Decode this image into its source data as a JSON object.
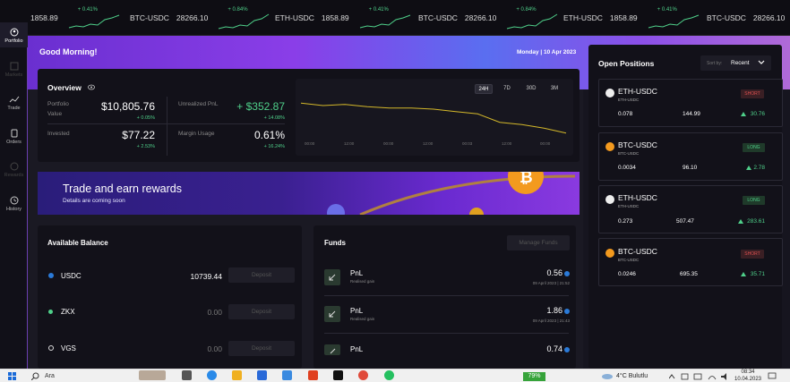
{
  "ticker": [
    {
      "pair": "",
      "price": "1858.89",
      "change": "+ 0.41%"
    },
    {
      "pair": "BTC-USDC",
      "price": "28266.10",
      "change": "+ 0.84%"
    },
    {
      "pair": "ETH-USDC",
      "price": "1858.89",
      "change": "+ 0.41%"
    },
    {
      "pair": "BTC-USDC",
      "price": "28266.10",
      "change": "+ 0.84%"
    },
    {
      "pair": "ETH-USDC",
      "price": "1858.89",
      "change": "+ 0.41%"
    },
    {
      "pair": "BTC-USDC",
      "price": "28266.10",
      "change": ""
    }
  ],
  "sidebar": {
    "items": [
      {
        "label": "Portfolio",
        "icon": "portfolio-icon"
      },
      {
        "label": "Markets",
        "icon": "markets-icon"
      },
      {
        "label": "Trade",
        "icon": "trade-icon"
      },
      {
        "label": "Orders",
        "icon": "orders-icon"
      },
      {
        "label": "Rewards",
        "icon": "rewards-icon"
      },
      {
        "label": "History",
        "icon": "history-icon"
      }
    ]
  },
  "header": {
    "greeting": "Good Morning!",
    "date": "Monday | 10 Apr 2023"
  },
  "overview": {
    "title": "Overview",
    "portfolio_label": "Portfolio\nValue",
    "portfolio_label_1": "Portfolio",
    "portfolio_label_2": "Value",
    "portfolio_value": "$10,805.76",
    "portfolio_change": "+ 0.05%",
    "unrealized_label": "Unrealized PnL",
    "unrealized_value": "+ $352.87",
    "unrealized_change": "+ 14.08%",
    "invested_label": "Invested",
    "invested_value": "$77.22",
    "invested_change": "+ 2.53%",
    "margin_label": "Margin Usage",
    "margin_value": "0.61%",
    "margin_change": "+ 16.24%",
    "timeframes": [
      "24H",
      "7D",
      "30D",
      "3M"
    ],
    "selected_timeframe": "24H",
    "x_ticks": [
      "00:00",
      "12:00",
      "00:00",
      "12:00",
      "00:03",
      "12:00",
      "00:00"
    ]
  },
  "chart_data": {
    "type": "line",
    "x": [
      "00:00",
      "12:00",
      "00:00",
      "12:00",
      "00:03",
      "12:00",
      "00:00"
    ],
    "series": [
      {
        "values": [
          10830,
          10828,
          10829,
          10827,
          10826,
          10826,
          10825,
          10823,
          10821,
          10814,
          10812,
          10809,
          10805
        ]
      }
    ],
    "grid": false
  },
  "promo": {
    "title": "Trade and earn rewards",
    "subtitle": "Details are coming soon"
  },
  "balance": {
    "title": "Available Balance",
    "rows": [
      {
        "asset": "USDC",
        "amount": "10739.44",
        "button": "Deposit",
        "color": "#2a7ad8"
      },
      {
        "asset": "ZKX",
        "amount": "0.00",
        "button": "Deposit",
        "color": "#4fd08a"
      },
      {
        "asset": "VGS",
        "amount": "0.00",
        "button": "Deposit",
        "color": "#dddddd"
      }
    ]
  },
  "funds": {
    "title": "Funds",
    "manage_label": "Manage Funds",
    "rows": [
      {
        "name": "PnL",
        "sub": "Realised gain",
        "value": "0.56",
        "date": "09 April 2023 | 21:52"
      },
      {
        "name": "PnL",
        "sub": "Realised gain",
        "value": "1.86",
        "date": "09 April 2023 | 21:43"
      },
      {
        "name": "PnL",
        "sub": "",
        "value": "0.74",
        "date": ""
      }
    ]
  },
  "positions": {
    "title": "Open Positions",
    "sort_label": "Sort by:",
    "sort_value": "Recent",
    "items": [
      {
        "pair": "ETH-USDC",
        "sub": "ETH-USDC",
        "side": "SHORT",
        "size": "0.078",
        "price": "144.99",
        "pnl": "30.76",
        "coin": "eth"
      },
      {
        "pair": "BTC-USDC",
        "sub": "BTC-USDC",
        "side": "LONG",
        "size": "0.0034",
        "price": "96.10",
        "pnl": "2.78",
        "coin": "btc"
      },
      {
        "pair": "ETH-USDC",
        "sub": "ETH-USDC",
        "side": "LONG",
        "size": "0.273",
        "price": "507.47",
        "pnl": "283.61",
        "coin": "eth"
      },
      {
        "pair": "BTC-USDC",
        "sub": "BTC-USDC",
        "side": "SHORT",
        "size": "0.0246",
        "price": "695.35",
        "pnl": "35.71",
        "coin": "btc"
      }
    ]
  },
  "taskbar": {
    "search": "Ara",
    "battery": "79%",
    "weather": "4°C  Bulutlu",
    "time": "08:34",
    "date": "10.04.2023"
  },
  "colors": {
    "accent": "#8a3ee8",
    "positive": "#4fd08a",
    "short": "#e05050",
    "long": "#4fd08a",
    "chart_line": "#d4b82a"
  }
}
